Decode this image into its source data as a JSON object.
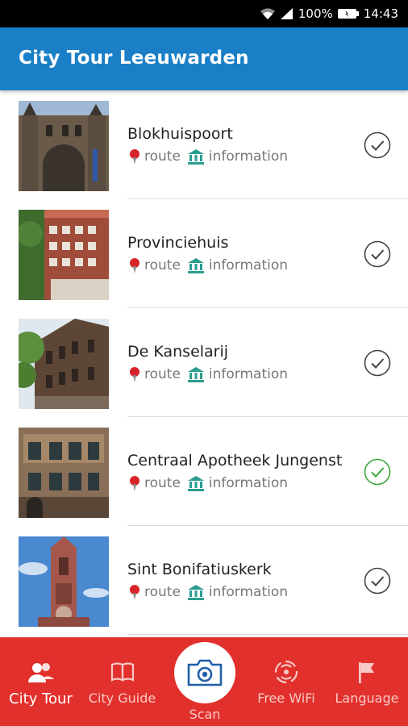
{
  "status_bar": {
    "battery": "100%",
    "time": "14:43"
  },
  "app_bar": {
    "title": "City Tour Leeuwarden"
  },
  "list": {
    "route_label": "route",
    "info_label": "information",
    "items": [
      {
        "title": "Blokhuispoort",
        "checked": true,
        "check_color": "#444444"
      },
      {
        "title": "Provinciehuis",
        "checked": true,
        "check_color": "#444444"
      },
      {
        "title": "De Kanselarij",
        "checked": true,
        "check_color": "#444444"
      },
      {
        "title": "Centraal Apotheek Jungenst",
        "checked": true,
        "check_color": "#3aa83a"
      },
      {
        "title": "Sint Bonifatiuskerk",
        "checked": true,
        "check_color": "#444444"
      }
    ]
  },
  "bottom_nav": {
    "items": [
      {
        "label": "City Tour",
        "icon": "people-icon",
        "active": true
      },
      {
        "label": "City Guide",
        "icon": "book-icon",
        "active": false
      },
      {
        "label": "Scan",
        "icon": "camera-icon",
        "active": false
      },
      {
        "label": "Free WiFi",
        "icon": "wifi-icon",
        "active": false
      },
      {
        "label": "Language",
        "icon": "flag-icon",
        "active": false
      }
    ]
  },
  "colors": {
    "app_bar": "#1a7fc6",
    "bottom_nav": "#e2302c",
    "pin": "#d8232a",
    "museum": "#2a9d8f"
  }
}
